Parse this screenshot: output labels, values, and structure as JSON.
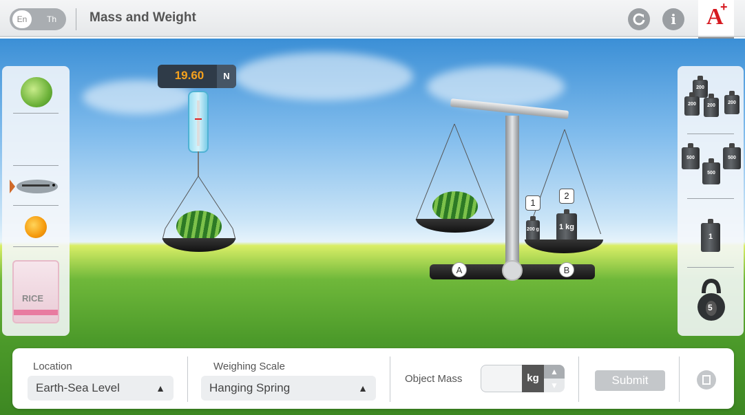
{
  "header": {
    "lang_en": "En",
    "lang_th": "Th",
    "title": "Mass and Weight"
  },
  "header_icons": [
    "reset-icon",
    "info-icon",
    "logo",
    "arrow-down-icon"
  ],
  "logo": {
    "letter": "A",
    "accent": "#d61920"
  },
  "spring_scale": {
    "reading": "19.60",
    "unit": "N",
    "readout_color": "#f6a11d"
  },
  "balance": {
    "marker_a": "A",
    "marker_b": "B",
    "weight_tags": [
      "1",
      "2"
    ],
    "small_weight_label": "200 g",
    "big_weight_label": "1 kg"
  },
  "left_objects": {
    "items": [
      "cabbage",
      "fish",
      "orange",
      "rice-bag"
    ],
    "rice_label": "RICE"
  },
  "right_weights": {
    "groups": [
      {
        "label": "200",
        "unit": "g"
      },
      {
        "label": "500",
        "unit": "g"
      },
      {
        "label": "1",
        "unit": "kg"
      },
      {
        "label": "5",
        "unit": "kg"
      }
    ]
  },
  "controls": {
    "location_label": "Location",
    "location_value": "Earth-Sea Level",
    "scale_label": "Weighing Scale",
    "scale_value": "Hanging Spring",
    "mass_label": "Object Mass",
    "mass_value": "",
    "mass_unit": "kg",
    "submit_label": "Submit"
  }
}
